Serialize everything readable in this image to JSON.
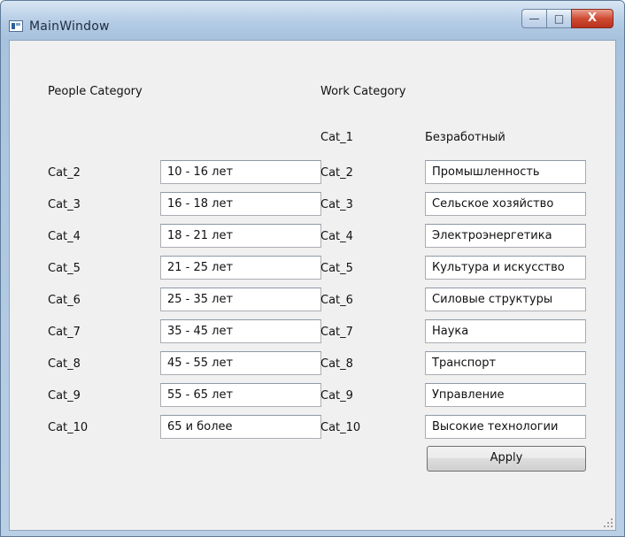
{
  "window": {
    "title": "MainWindow",
    "minimize_glyph": "—",
    "maximize_glyph": "□",
    "close_glyph": "X"
  },
  "people": {
    "heading": "People Category",
    "rows": [
      {
        "label": "Cat_2",
        "value": "10 - 16 лет"
      },
      {
        "label": "Cat_3",
        "value": "16 - 18 лет"
      },
      {
        "label": "Cat_4",
        "value": "18 - 21 лет"
      },
      {
        "label": "Cat_5",
        "value": "21 - 25 лет"
      },
      {
        "label": "Cat_6",
        "value": "25 - 35 лет"
      },
      {
        "label": "Cat_7",
        "value": "35 - 45 лет"
      },
      {
        "label": "Cat_8",
        "value": "45 - 55 лет"
      },
      {
        "label": "Cat_9",
        "value": "55 - 65 лет"
      },
      {
        "label": "Cat_10",
        "value": "65 и более"
      }
    ]
  },
  "work": {
    "heading": "Work Category",
    "first": {
      "label": "Cat_1",
      "value": "Безработный"
    },
    "rows": [
      {
        "label": "Cat_2",
        "value": "Промышленность"
      },
      {
        "label": "Cat_3",
        "value": "Сельское хозяйство"
      },
      {
        "label": "Cat_4",
        "value": "Электроэнергетика"
      },
      {
        "label": "Cat_5",
        "value": "Культура и искусство"
      },
      {
        "label": "Cat_6",
        "value": "Силовые структуры"
      },
      {
        "label": "Cat_7",
        "value": "Наука"
      },
      {
        "label": "Cat_8",
        "value": "Транспорт"
      },
      {
        "label": "Cat_9",
        "value": "Управление"
      },
      {
        "label": "Cat_10",
        "value": "Высокие технологии"
      }
    ]
  },
  "apply_label": "Apply"
}
